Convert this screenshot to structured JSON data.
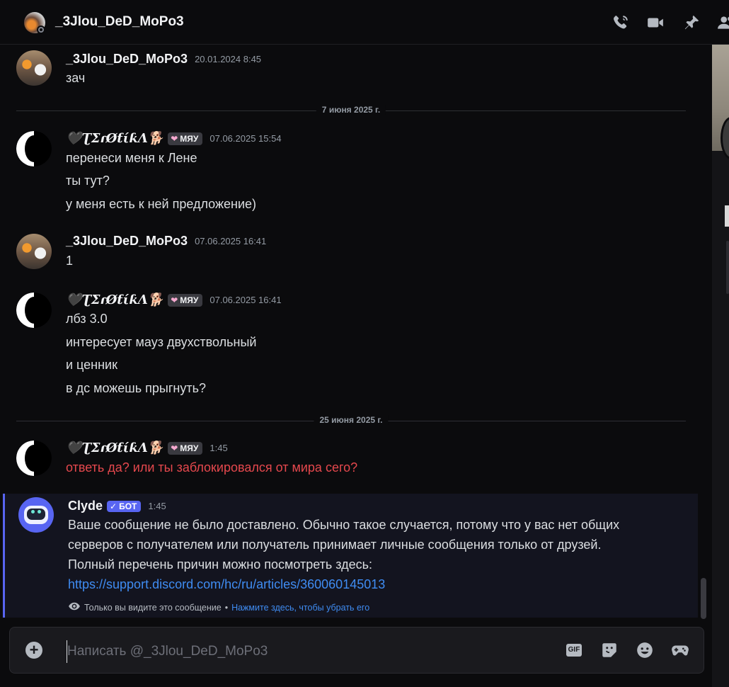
{
  "header": {
    "title": "_3Jlou_DeD_MoPo3",
    "icons": [
      "voice-call-icon",
      "video-call-icon",
      "pin-icon",
      "member-list-icon"
    ]
  },
  "dividers": [
    {
      "label": "7 июня 2025 г."
    },
    {
      "label": "25 июня 2025 г."
    }
  ],
  "messages": [
    {
      "author": "_3Jlou_DeD_MoPo3",
      "time": "20.01.2024 8:45",
      "lines": [
        "зач"
      ]
    },
    {
      "author": "🖤ƮΣɾØƭίƙΛ🐕",
      "tag": "МЯУ",
      "time": "07.06.2025 15:54",
      "lines": [
        "перенеси меня к Лене",
        "ты тут?",
        "у меня есть к ней предложение)"
      ]
    },
    {
      "author": "_3Jlou_DeD_MoPo3",
      "time": "07.06.2025 16:41",
      "lines": [
        "1"
      ]
    },
    {
      "author": "🖤ƮΣɾØƭίƙΛ🐕",
      "tag": "МЯУ",
      "time": "07.06.2025 16:41",
      "lines": [
        "лбз 3.0",
        "интересует мауз двухствольный",
        "и ценник",
        "в дс можешь прыгнуть?"
      ]
    },
    {
      "author": "🖤ƮΣɾØƭίƙΛ🐕",
      "tag": "МЯУ",
      "time": "1:45",
      "lines": [
        "ответь да? или ты заблокировался от мира сего?"
      ],
      "failed": true
    }
  ],
  "clyde": {
    "author": "Clyde",
    "bot_tag": "БОТ",
    "time": "1:45",
    "text_lines": [
      "Ваше сообщение не было доставлено. Обычно такое случается, потому что у вас нет общих",
      "серверов с получателем или получатель принимает личные сообщения только от друзей.",
      "Полный перечень причин можно посмотреть здесь:"
    ],
    "link": "https://support.discord.com/hc/ru/articles/360060145013",
    "note": "Только вы видите это сообщение",
    "note_sep": "•",
    "dismiss": "Нажмите здесь, чтобы убрать его"
  },
  "composer": {
    "placeholder": "Написать @_3Jlou_DeD_MoPo3",
    "gif_label": "GIF",
    "icons": [
      "add-attachment-icon",
      "gif-icon",
      "sticker-icon",
      "emoji-icon",
      "activities-icon"
    ]
  },
  "colors": {
    "background": "#0b0b0d",
    "accent": "#5865f2",
    "link": "#3f8cf2",
    "failed_text": "#e5484d"
  }
}
